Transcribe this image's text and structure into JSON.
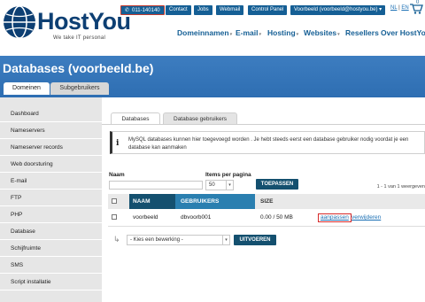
{
  "header": {
    "brand": "HostYou",
    "tagline": "We take IT personal",
    "phone": "011-140140",
    "top_links": [
      "Contact",
      "Jobs",
      "Webmail",
      "Control Panel"
    ],
    "account": "Voorbeeld (voorbeeld@hostyou.be) ▾",
    "lang_nl": "NL",
    "lang_sep": "|",
    "lang_en": "EN",
    "cart_count": "0",
    "nav": [
      {
        "label": "Domeinnamen",
        "caret": "▾"
      },
      {
        "label": "E-mail",
        "caret": "▾"
      },
      {
        "label": "Hosting",
        "caret": "▾"
      },
      {
        "label": "Websites",
        "caret": "▾"
      },
      {
        "label": "Resellers",
        "caret": ""
      },
      {
        "label": "Over HostYou",
        "caret": ""
      }
    ]
  },
  "banner": {
    "title": "Databases (voorbeeld.be)",
    "tabs": [
      "Domeinen",
      "Subgebruikers"
    ]
  },
  "sidebar": {
    "items": [
      "Dashboard",
      "Nameservers",
      "Nameserver records",
      "Web doorsturing",
      "E-mail",
      "FTP",
      "PHP",
      "Database",
      "Schijfruimte",
      "SMS",
      "Script installatie"
    ]
  },
  "content": {
    "subtabs": [
      "Databases",
      "Database gebruikers"
    ],
    "info_icon": "i",
    "info_text": "MySQL databases kunnen hier toegevoegd worden . Je hebt steeds eerst een database gebruiker nodig voordat je een database kan aanmaken",
    "filter": {
      "name_label": "Naam",
      "name_value": "",
      "perpage_label": "Items per pagina",
      "perpage_value": "50",
      "apply_label": "TOEPASSEN"
    },
    "result_count": "1 - 1 van 1 weergeven",
    "table": {
      "headers": [
        "NAAM",
        "GEBRUIKERS",
        "SIZE"
      ],
      "rows": [
        {
          "name": "voorbeeld",
          "user": "dbvoorb001",
          "size": "0.00 / 50 MB",
          "edit": "aanpassen",
          "delete": "verwijderen"
        }
      ]
    },
    "bulk": {
      "arrow": "↳",
      "select_value": "- Kies een bewerking -",
      "execute_label": "UITVOEREN"
    }
  },
  "colors": {
    "brand": "#0d3f73",
    "banner": "#2e6eb2",
    "button": "#14506f",
    "highlight": "#d62a2a"
  }
}
